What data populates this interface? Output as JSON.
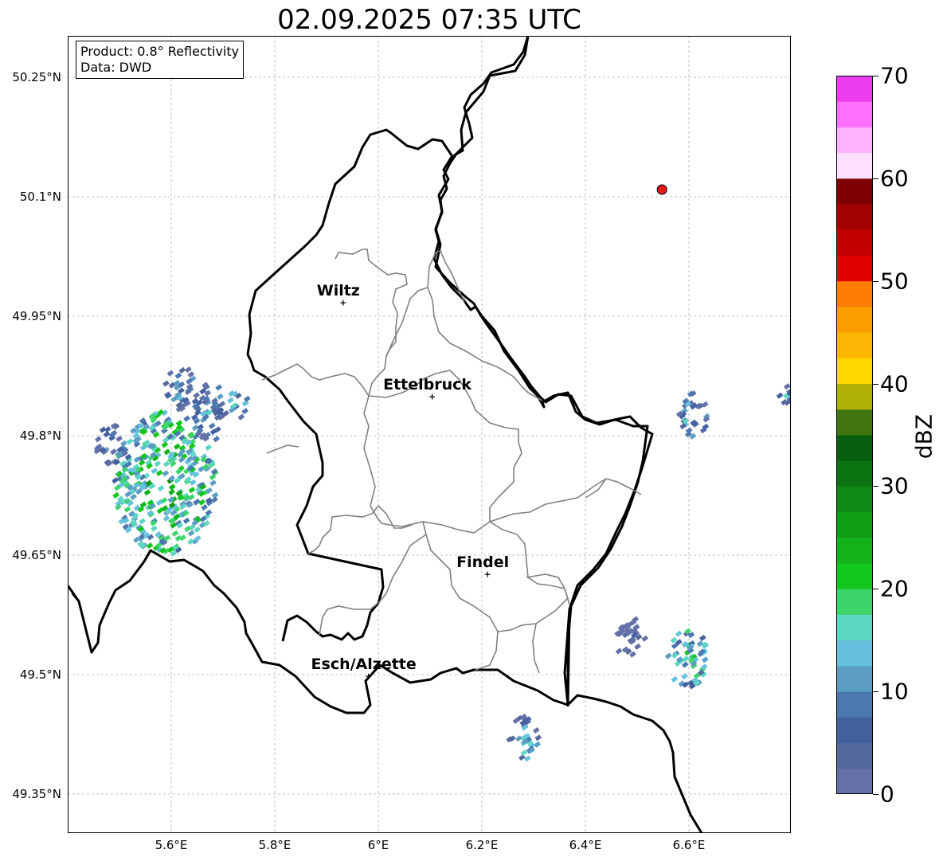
{
  "title": "02.09.2025 07:35 UTC",
  "info": {
    "product": "Product: 0.8° Reflectivity",
    "source": "Data: DWD"
  },
  "axes": {
    "lon_ticks": [
      {
        "value": 5.6,
        "label": "5.6°E"
      },
      {
        "value": 5.8,
        "label": "5.8°E"
      },
      {
        "value": 6.0,
        "label": "6°E"
      },
      {
        "value": 6.2,
        "label": "6.2°E"
      },
      {
        "value": 6.4,
        "label": "6.4°E"
      },
      {
        "value": 6.6,
        "label": "6.6°E"
      }
    ],
    "lat_ticks": [
      {
        "value": 50.25,
        "label": "50.25°N"
      },
      {
        "value": 50.1,
        "label": "50.1°N"
      },
      {
        "value": 49.95,
        "label": "49.95°N"
      },
      {
        "value": 49.8,
        "label": "49.8°N"
      },
      {
        "value": 49.65,
        "label": "49.65°N"
      },
      {
        "value": 49.5,
        "label": "49.5°N"
      },
      {
        "value": 49.35,
        "label": "49.35°N"
      }
    ],
    "lon_range": [
      5.4,
      6.8
    ],
    "lat_range": [
      49.3,
      50.3
    ],
    "grid": true
  },
  "cities": [
    {
      "name": "Wiltz",
      "lon": 5.932,
      "lat": 49.966
    },
    {
      "name": "Ettelbruck",
      "lon": 6.104,
      "lat": 49.848
    },
    {
      "name": "Findel",
      "lon": 6.211,
      "lat": 49.625
    },
    {
      "name": "Esch/Alzette",
      "lon": 5.981,
      "lat": 49.497
    }
  ],
  "radar_site": {
    "lon": 6.548,
    "lat": 50.109,
    "color": "#e31a1c"
  },
  "colorbar": {
    "label": "dBZ",
    "ticks": [
      "0",
      "10",
      "20",
      "30",
      "40",
      "50",
      "60",
      "70"
    ],
    "colors": [
      "#6471a8",
      "#54689e",
      "#43609f",
      "#4c78b0",
      "#5b9dc4",
      "#65c1dd",
      "#5dd6c3",
      "#3dd46c",
      "#12c71b",
      "#11b21a",
      "#109d16",
      "#0e8913",
      "#0b7410",
      "#075e0c",
      "#417510",
      "#afb108",
      "#ffd800",
      "#fbb502",
      "#fd9d00",
      "#fe7d02",
      "#e00000",
      "#c20000",
      "#a30000",
      "#7d0000",
      "#ffe0ff",
      "#ffb3ff",
      "#ff6efc",
      "#eb3cf0"
    ]
  },
  "chart_data": {
    "type": "heatmap",
    "title": "02.09.2025 07:35 UTC",
    "xlabel": "",
    "ylabel": "",
    "variable": "0.8° Reflectivity",
    "unit": "dBZ",
    "value_range": [
      0,
      70
    ],
    "xlim": [
      5.4,
      6.8
    ],
    "ylim": [
      49.3,
      50.3
    ],
    "echo_cells": [
      {
        "lon": 5.486,
        "lat": 49.79,
        "dbz": 14,
        "size": 0.03
      },
      {
        "lon": 5.59,
        "lat": 49.74,
        "dbz": 25,
        "size": 0.1
      },
      {
        "lon": 5.62,
        "lat": 49.86,
        "dbz": 15,
        "size": 0.03
      },
      {
        "lon": 5.68,
        "lat": 49.83,
        "dbz": 13,
        "size": 0.04
      },
      {
        "lon": 5.73,
        "lat": 49.84,
        "dbz": 19,
        "size": 0.02
      },
      {
        "lon": 6.61,
        "lat": 49.826,
        "dbz": 16,
        "size": 0.03
      },
      {
        "lon": 6.79,
        "lat": 49.85,
        "dbz": 16,
        "size": 0.015
      },
      {
        "lon": 6.49,
        "lat": 49.545,
        "dbz": 5,
        "size": 0.03
      },
      {
        "lon": 6.6,
        "lat": 49.52,
        "dbz": 22,
        "size": 0.04
      },
      {
        "lon": 6.28,
        "lat": 49.42,
        "dbz": 18,
        "size": 0.03
      }
    ]
  }
}
